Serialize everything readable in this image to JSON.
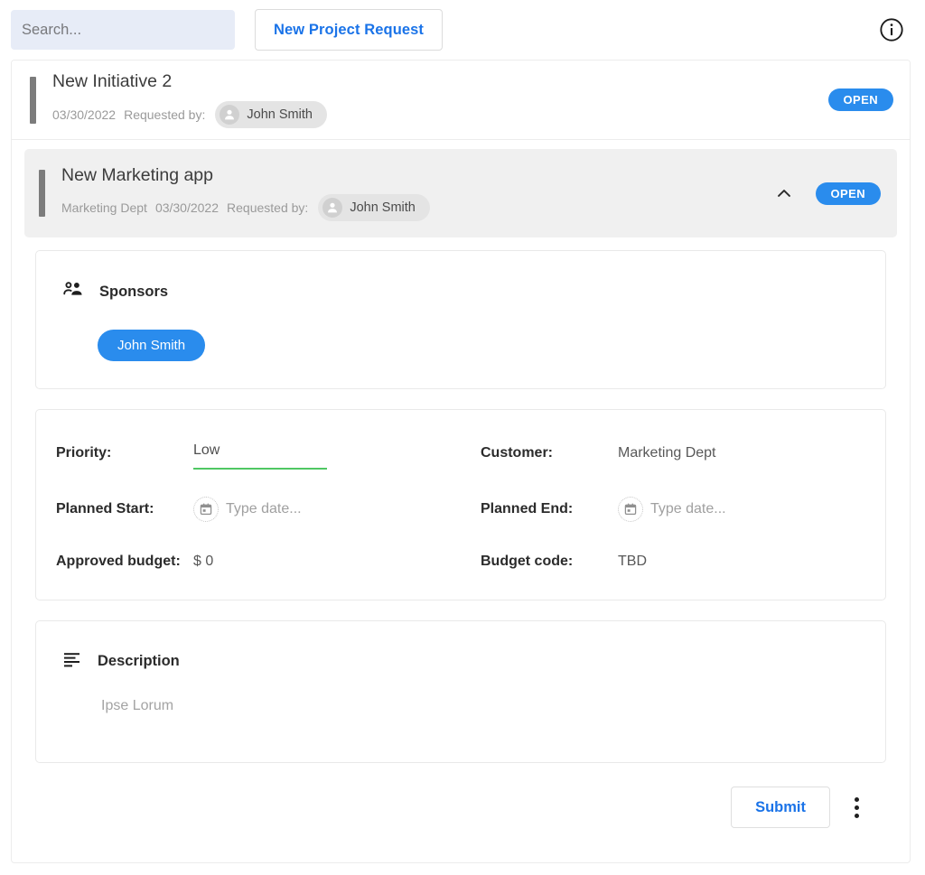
{
  "toolbar": {
    "search_placeholder": "Search...",
    "search_value": "",
    "new_request_label": "New Project Request",
    "info_icon": "info-circle-icon"
  },
  "colors": {
    "accent_blue": "#2a8ced",
    "link_blue": "#1a73e8",
    "priority_underline_green": "#4fc763",
    "row_accent_bar": "#7c7c7c",
    "search_background": "#e7ecf7",
    "expanded_header_background": "#f0f0f0"
  },
  "requests": [
    {
      "title": "New Initiative 2",
      "department": "",
      "date": "03/30/2022",
      "requested_by_label": "Requested by:",
      "requester": "John Smith",
      "status": "OPEN",
      "expanded": false
    },
    {
      "title": "New Marketing app",
      "department": "Marketing Dept",
      "date": "03/30/2022",
      "requested_by_label": "Requested by:",
      "requester": "John Smith",
      "status": "OPEN",
      "expanded": true,
      "collapse_icon": "chevron-up-icon"
    }
  ],
  "detail": {
    "sponsors": {
      "icon": "people-icon",
      "title": "Sponsors",
      "chips": [
        "John Smith"
      ]
    },
    "fields": {
      "priority": {
        "label": "Priority:",
        "value": "Low"
      },
      "customer": {
        "label": "Customer:",
        "value": "Marketing Dept"
      },
      "planned_start": {
        "label": "Planned Start:",
        "placeholder": "Type date...",
        "icon": "calendar-icon"
      },
      "planned_end": {
        "label": "Planned End:",
        "placeholder": "Type date...",
        "icon": "calendar-icon"
      },
      "approved_budget": {
        "label": "Approved budget:",
        "value": "$ 0"
      },
      "budget_code": {
        "label": "Budget code:",
        "value": "TBD"
      }
    },
    "description": {
      "icon": "subject-lines-icon",
      "title": "Description",
      "text": "Ipse Lorum"
    },
    "actions": {
      "submit_label": "Submit",
      "more_icon": "kebab-menu-icon"
    }
  }
}
